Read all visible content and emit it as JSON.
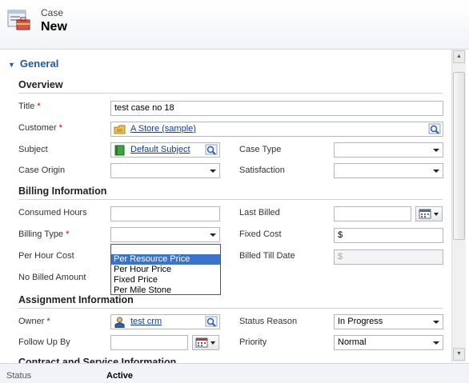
{
  "header": {
    "entity": "Case",
    "title": "New"
  },
  "tab": {
    "label": "General"
  },
  "sections": {
    "overview": "Overview",
    "billing": "Billing Information",
    "assignment": "Assignment Information",
    "next": "Contract and Service Information"
  },
  "fields": {
    "title": {
      "label": "Title",
      "value": "test case no 18"
    },
    "customer": {
      "label": "Customer",
      "value": "A Store (sample)"
    },
    "subject": {
      "label": "Subject",
      "value": "Default Subject"
    },
    "case_type": {
      "label": "Case Type",
      "value": ""
    },
    "case_origin": {
      "label": "Case Origin",
      "value": ""
    },
    "satisfaction": {
      "label": "Satisfaction",
      "value": ""
    },
    "consumed_hours": {
      "label": "Consumed Hours",
      "value": ""
    },
    "last_billed": {
      "label": "Last Billed",
      "value": ""
    },
    "billing_type": {
      "label": "Billing Type",
      "value": ""
    },
    "fixed_cost": {
      "label": "Fixed Cost",
      "value": "$"
    },
    "per_hour_cost": {
      "label": "Per Hour Cost"
    },
    "billed_till_date": {
      "label": "Billed Till Date",
      "placeholder": "$"
    },
    "no_billed_amount": {
      "label": "No Billed Amount"
    },
    "owner": {
      "label": "Owner",
      "value": "test crm"
    },
    "status_reason": {
      "label": "Status Reason",
      "value": "In Progress"
    },
    "follow_up_by": {
      "label": "Follow Up By",
      "value": ""
    },
    "priority": {
      "label": "Priority",
      "value": "Normal"
    }
  },
  "billing_type_options": [
    "",
    "Per Resource Price",
    "Per Hour Price",
    "Fixed Price",
    "Per Mile Stone"
  ],
  "highlighted_option": "Per Resource Price",
  "footer": {
    "status_label": "Status",
    "status_value": "Active"
  },
  "icons": {
    "header": "case-form-icon",
    "customer": "account-icon",
    "subject": "subject-icon",
    "owner": "user-icon",
    "lookup": "lookup-icon",
    "calendar": "calendar-icon"
  },
  "colors": {
    "tab_header": "#1c5a9c",
    "required": "#cc0000",
    "link": "#0b3bb0",
    "highlight": "#3a73c9"
  }
}
